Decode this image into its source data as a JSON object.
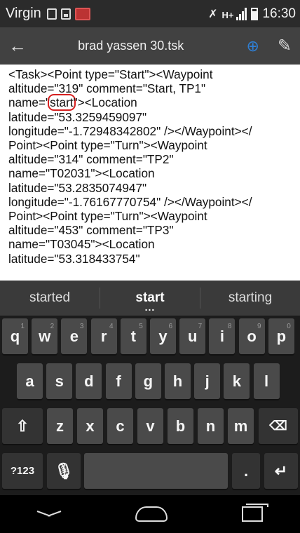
{
  "status_bar": {
    "carrier": "Virgin",
    "network": "H+",
    "time": "16:30"
  },
  "app_bar": {
    "title": "brad yassen 30.tsk"
  },
  "editor": {
    "lines": [
      "<Task><Point type=\"Start\"><Waypoint",
      "altitude=\"319\" comment=\"Start, TP1\"",
      "name=\"start\"><Location",
      "latitude=\"53.3259459097\"",
      "longitude=\"-1.72948342802\" /></Waypoint></",
      "Point><Point type=\"Turn\"><Waypoint",
      "altitude=\"314\" comment=\"TP2\"",
      "name=\"T02031\"><Location",
      "latitude=\"53.2835074947\"",
      "longitude=\"-1.76167770754\" /></Waypoint></",
      "Point><Point type=\"Turn\"><Waypoint",
      "altitude=\"453\" comment=\"TP3\"",
      "name=\"T03045\"><Location",
      "latitude=\"53.318433754\""
    ],
    "highlight_prefix": "name=\"",
    "highlight_word": "start",
    "highlight_suffix": "\"><Location"
  },
  "suggestions": [
    "started",
    "start",
    "starting"
  ],
  "keyboard": {
    "row1": [
      "q",
      "w",
      "e",
      "r",
      "t",
      "y",
      "u",
      "i",
      "o",
      "p"
    ],
    "row1_hints": [
      "1",
      "2",
      "3",
      "4",
      "5",
      "6",
      "7",
      "8",
      "9",
      "0"
    ],
    "row2": [
      "a",
      "s",
      "d",
      "f",
      "g",
      "h",
      "j",
      "k",
      "l"
    ],
    "row3": [
      "z",
      "x",
      "c",
      "v",
      "b",
      "n",
      "m"
    ],
    "symbols_label": "?123",
    "period_label": "."
  }
}
